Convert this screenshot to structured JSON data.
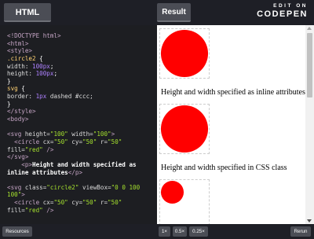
{
  "header": {
    "html_tab": "HTML",
    "result_tab": "Result",
    "edit_on": "EDIT ON",
    "brand": "CODEPEN"
  },
  "editor": {
    "lines": [
      [
        {
          "c": "tag",
          "t": "<!DOCTYPE html>"
        }
      ],
      [
        {
          "c": "tag",
          "t": "<html>"
        }
      ],
      [
        {
          "c": "tag",
          "t": "<style>"
        }
      ],
      [
        {
          "c": "sel",
          "t": ".circle2"
        },
        {
          "c": "punct",
          "t": " {"
        }
      ],
      [
        {
          "c": "prop",
          "t": "width: "
        },
        {
          "c": "num",
          "t": "100px"
        },
        {
          "c": "punct",
          "t": ";"
        }
      ],
      [
        {
          "c": "prop",
          "t": "height: "
        },
        {
          "c": "num",
          "t": "100px"
        },
        {
          "c": "punct",
          "t": ";"
        }
      ],
      [
        {
          "c": "punct",
          "t": "}"
        }
      ],
      [
        {
          "c": "sel",
          "t": "svg"
        },
        {
          "c": "punct",
          "t": " {"
        }
      ],
      [
        {
          "c": "prop",
          "t": "border: "
        },
        {
          "c": "num",
          "t": "1px"
        },
        {
          "c": "prop",
          "t": " dashed #ccc;"
        }
      ],
      [
        {
          "c": "punct",
          "t": "}"
        }
      ],
      [
        {
          "c": "tag",
          "t": "</style>"
        }
      ],
      [
        {
          "c": "tag",
          "t": "<body>"
        }
      ],
      [
        {
          "c": "txt",
          "t": ""
        }
      ],
      [
        {
          "c": "tag",
          "t": "<svg "
        },
        {
          "c": "attr",
          "t": "height="
        },
        {
          "c": "str",
          "t": "\"100\""
        },
        {
          "c": "attr",
          "t": " width="
        },
        {
          "c": "str",
          "t": "\"100\""
        },
        {
          "c": "tag",
          "t": ">"
        }
      ],
      [
        {
          "c": "tag",
          "t": "  <circle "
        },
        {
          "c": "attr",
          "t": "cx="
        },
        {
          "c": "str",
          "t": "\"50\""
        },
        {
          "c": "attr",
          "t": " cy="
        },
        {
          "c": "str",
          "t": "\"50\""
        },
        {
          "c": "attr",
          "t": " r="
        },
        {
          "c": "str",
          "t": "\"50\""
        }
      ],
      [
        {
          "c": "attr",
          "t": "fill="
        },
        {
          "c": "str",
          "t": "\"red\""
        },
        {
          "c": "tag",
          "t": " />"
        }
      ],
      [
        {
          "c": "tag",
          "t": "</svg>"
        }
      ],
      [
        {
          "c": "tag",
          "t": "    <p>"
        },
        {
          "c": "txt",
          "t": "Height and width specified as"
        }
      ],
      [
        {
          "c": "txt",
          "t": "inline attributes"
        },
        {
          "c": "tag",
          "t": "</p>"
        }
      ],
      [
        {
          "c": "txt",
          "t": ""
        }
      ],
      [
        {
          "c": "tag",
          "t": "<svg "
        },
        {
          "c": "attr",
          "t": "class="
        },
        {
          "c": "str",
          "t": "\"circle2\""
        },
        {
          "c": "attr",
          "t": " viewBox="
        },
        {
          "c": "str",
          "t": "\"0 0 100"
        }
      ],
      [
        {
          "c": "str",
          "t": "100\""
        },
        {
          "c": "tag",
          "t": ">"
        }
      ],
      [
        {
          "c": "tag",
          "t": "  <circle "
        },
        {
          "c": "attr",
          "t": "cx="
        },
        {
          "c": "str",
          "t": "\"50\""
        },
        {
          "c": "attr",
          "t": " cy="
        },
        {
          "c": "str",
          "t": "\"50\""
        },
        {
          "c": "attr",
          "t": " r="
        },
        {
          "c": "str",
          "t": "\"50\""
        }
      ],
      [
        {
          "c": "attr",
          "t": "fill="
        },
        {
          "c": "str",
          "t": "\"red\""
        },
        {
          "c": "tag",
          "t": " />"
        }
      ]
    ]
  },
  "result": {
    "caption1": "Height and width specified as inline attributes",
    "caption2": "Height and width specified in CSS class",
    "circle_color": "#ff0000"
  },
  "footer": {
    "resources": "Resources",
    "zoom_1x": "1×",
    "zoom_05x": "0.5×",
    "zoom_025x": "0.25×",
    "rerun": "Rerun"
  }
}
